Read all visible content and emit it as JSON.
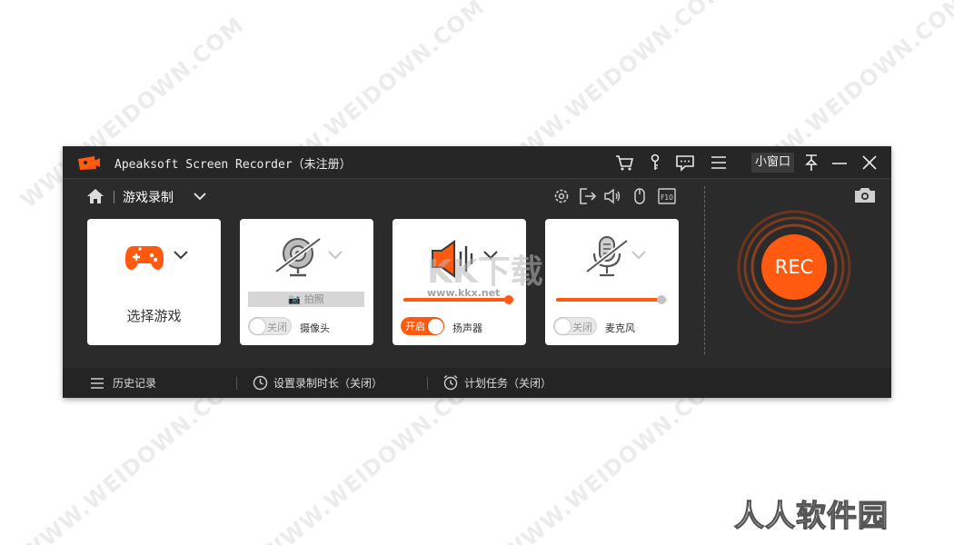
{
  "watermark": {
    "text": "WWW.WEIDOWN.COM",
    "brand": "人人软件园",
    "site_logo": "KK下载",
    "site_url": "www.kkx.net"
  },
  "window": {
    "title": "Apeaksoft Screen Recorder（未注册）",
    "mini_window_label": "小窗口",
    "titlebar_icons": [
      "cart-icon",
      "key-icon",
      "chat-icon",
      "menu-icon",
      "pin-icon",
      "minimize-icon",
      "close-icon"
    ]
  },
  "navbar": {
    "mode_label": "游戏录制",
    "option_icons": [
      "settings-icon",
      "export-icon",
      "speaker-icon",
      "mouse-icon",
      "f10-icon"
    ]
  },
  "cards": {
    "game": {
      "label": "选择游戏"
    },
    "camera": {
      "snapshot_label": "拍照",
      "toggle_state_label": "关闭",
      "device_label": "摄像头",
      "enabled": false
    },
    "speaker": {
      "toggle_state_label": "开启",
      "device_label": "扬声器",
      "enabled": true,
      "volume": 0.95
    },
    "microphone": {
      "toggle_state_label": "关闭",
      "device_label": "麦克风",
      "enabled": false,
      "volume": 0.95
    }
  },
  "rec": {
    "label": "REC"
  },
  "footer": {
    "history": "历史记录",
    "duration": "设置录制时长（关闭）",
    "schedule": "计划任务（关闭）"
  },
  "colors": {
    "accent": "#ff5a10",
    "window_bg": "#2b2b2b",
    "titlebar_bg": "#262626"
  }
}
